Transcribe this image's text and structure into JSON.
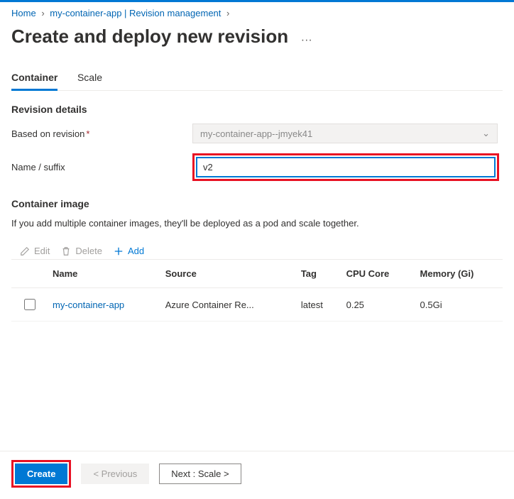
{
  "breadcrumb": {
    "home": "Home",
    "app": "my-container-app | Revision management"
  },
  "page": {
    "title": "Create and deploy new revision"
  },
  "tabs": {
    "container": "Container",
    "scale": "Scale"
  },
  "revision": {
    "heading": "Revision details",
    "based_label": "Based on revision",
    "based_value": "my-container-app--jmyek41",
    "suffix_label": "Name / suffix",
    "suffix_value": "v2"
  },
  "container": {
    "heading": "Container image",
    "desc": "If you add multiple container images, they'll be deployed as a pod and scale together.",
    "toolbar": {
      "edit": "Edit",
      "delete": "Delete",
      "add": "Add"
    },
    "columns": {
      "name": "Name",
      "source": "Source",
      "tag": "Tag",
      "cpu": "CPU Core",
      "mem": "Memory (Gi)"
    },
    "rows": [
      {
        "name": "my-container-app",
        "source": "Azure Container Re...",
        "tag": "latest",
        "cpu": "0.25",
        "mem": "0.5Gi"
      }
    ]
  },
  "footer": {
    "create": "Create",
    "prev": "< Previous",
    "next": "Next : Scale >"
  }
}
